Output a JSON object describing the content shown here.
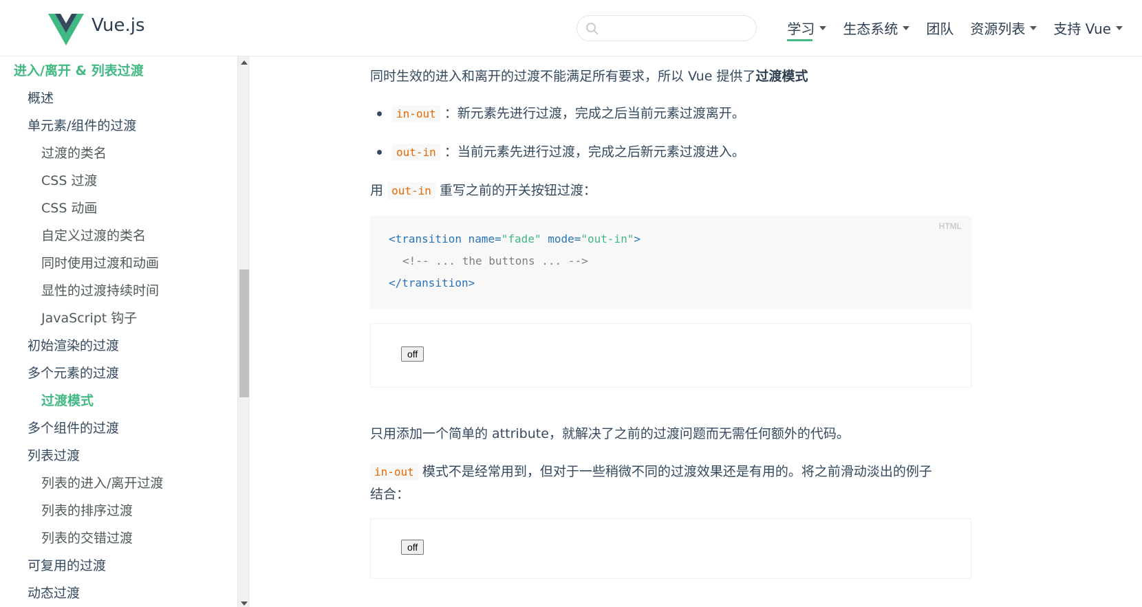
{
  "header": {
    "brand": "Vue.js",
    "search": {
      "placeholder": "",
      "value": ""
    },
    "nav": [
      {
        "label": "学习",
        "dropdown": true,
        "active": true
      },
      {
        "label": "生态系统",
        "dropdown": true
      },
      {
        "label": "团队",
        "dropdown": false
      },
      {
        "label": "资源列表",
        "dropdown": true
      },
      {
        "label": "支持 Vue",
        "dropdown": true
      }
    ]
  },
  "sidebar": {
    "section_title": "进入/离开 & 列表过渡",
    "items": [
      {
        "label": "概述",
        "level": 1
      },
      {
        "label": "单元素/组件的过渡",
        "level": 1
      },
      {
        "label": "过渡的类名",
        "level": 2
      },
      {
        "label": "CSS 过渡",
        "level": 2
      },
      {
        "label": "CSS 动画",
        "level": 2
      },
      {
        "label": "自定义过渡的类名",
        "level": 2
      },
      {
        "label": "同时使用过渡和动画",
        "level": 2
      },
      {
        "label": "显性的过渡持续时间",
        "level": 2
      },
      {
        "label": "JavaScript 钩子",
        "level": 2
      },
      {
        "label": "初始渲染的过渡",
        "level": 1
      },
      {
        "label": "多个元素的过渡",
        "level": 1
      },
      {
        "label": "过渡模式",
        "level": 2,
        "current": true
      },
      {
        "label": "多个组件的过渡",
        "level": 1
      },
      {
        "label": "列表过渡",
        "level": 1
      },
      {
        "label": "列表的进入/离开过渡",
        "level": 2
      },
      {
        "label": "列表的排序过渡",
        "level": 2
      },
      {
        "label": "列表的交错过渡",
        "level": 2
      },
      {
        "label": "可复用的过渡",
        "level": 1
      },
      {
        "label": "动态过渡",
        "level": 1
      }
    ]
  },
  "content": {
    "intro_text": "同时生效的进入和离开的过渡不能满足所有要求，所以 Vue 提供了",
    "intro_bold": "过渡模式",
    "modes": [
      {
        "code": "in-out",
        "text": "：新元素先进行过渡，完成之后当前元素过渡离开。"
      },
      {
        "code": "out-in",
        "text": "：当前元素先进行过渡，完成之后新元素过渡进入。"
      }
    ],
    "rewrite_prefix": "用",
    "rewrite_code": "out-in",
    "rewrite_suffix": "重写之前的开关按钮过渡：",
    "code_block": {
      "lang": "HTML",
      "line1_open": "<transition",
      "line1_attr1": "name",
      "line1_val1": "\"fade\"",
      "line1_attr2": "mode",
      "line1_val2": "\"out-in\"",
      "line1_close": ">",
      "line2": "<!-- ... the buttons ... -->",
      "line3": "</transition>"
    },
    "demo1_button": "off",
    "after_demo_text": "只用添加一个简单的 attribute，就解决了之前的过渡问题而无需任何额外的代码。",
    "inout_code": "in-out",
    "inout_text_line1": "模式不是经常用到，但对于一些稍微不同的过渡效果还是有用的。将之前滑动淡出的例子",
    "inout_text_line2": "结合：",
    "demo2_button": "off"
  },
  "colors": {
    "accent": "#42b983",
    "text": "#34495e",
    "code_inline": "#e96900",
    "code_tag": "#2973b7"
  }
}
